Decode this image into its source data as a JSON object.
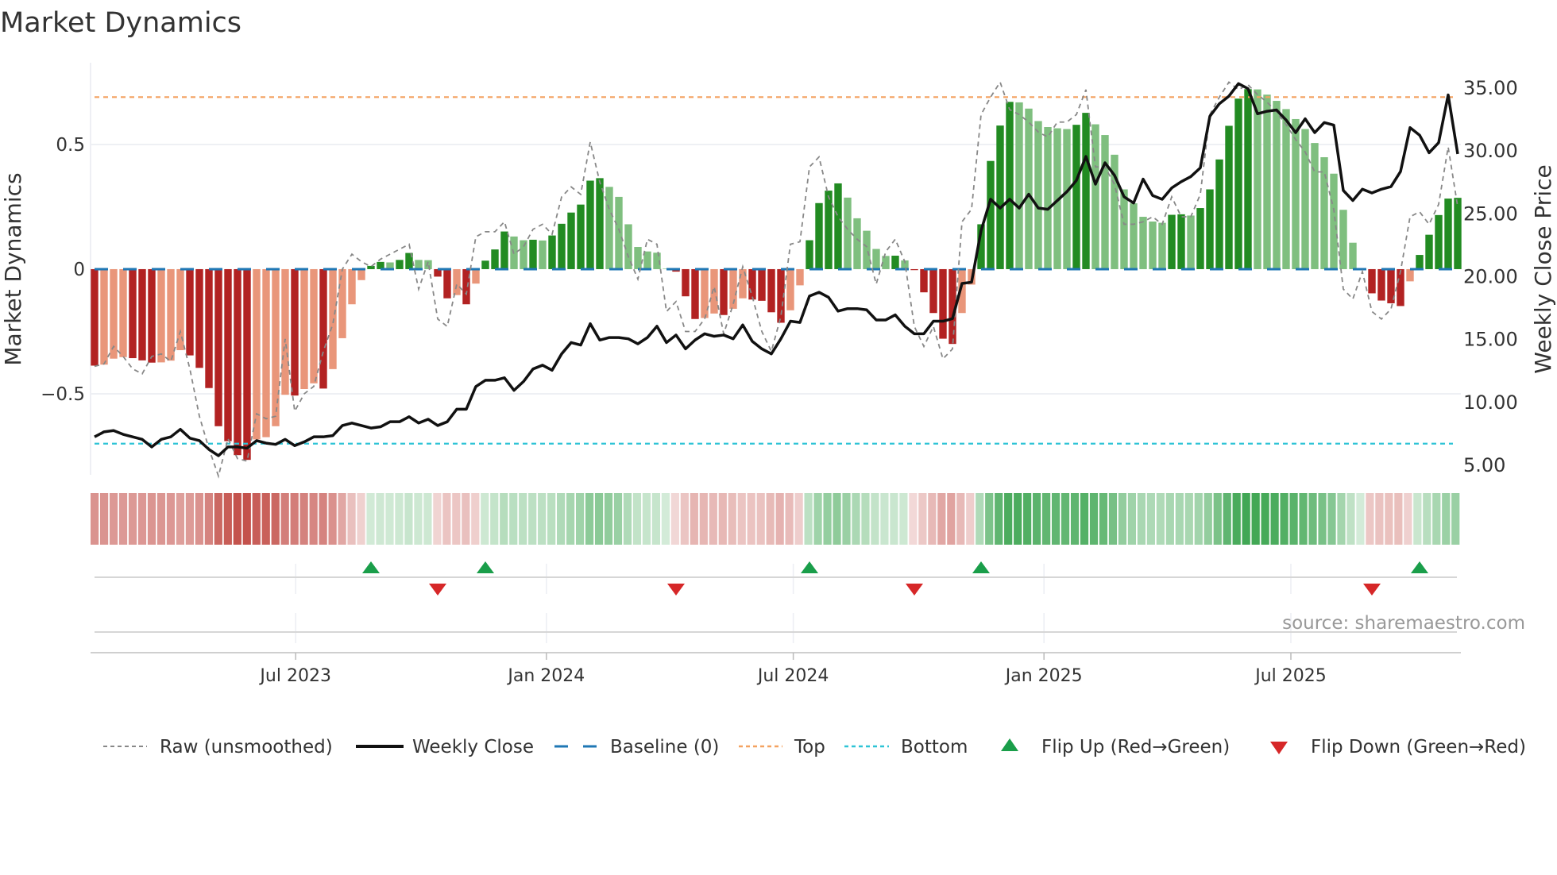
{
  "chart_data": {
    "type": "bar",
    "title": "Market Dynamics",
    "ylabel": "Market Dynamics",
    "y2label": "Weekly Close Price",
    "ylim": [
      -0.825,
      0.828
    ],
    "y2lim": [
      4.18,
      36.96
    ],
    "yticks": [
      {
        "value": 0.5,
        "label": "0.5"
      },
      {
        "value": 0,
        "label": "0"
      },
      {
        "value": -0.5,
        "label": "−0.5"
      }
    ],
    "y2ticks": [
      {
        "value": 35,
        "label": "35.00"
      },
      {
        "value": 30,
        "label": "30.00"
      },
      {
        "value": 25,
        "label": "25.00"
      },
      {
        "value": 20,
        "label": "20.00"
      },
      {
        "value": 15,
        "label": "15.00"
      },
      {
        "value": 10,
        "label": "10.00"
      },
      {
        "value": 5,
        "label": "5.00"
      }
    ],
    "x_unit": "week index",
    "xticks": [
      {
        "week": 21.1,
        "label": "Jul 2023"
      },
      {
        "week": 47.4,
        "label": "Jan 2024"
      },
      {
        "week": 73.3,
        "label": "Jul 2024"
      },
      {
        "week": 99.6,
        "label": "Jan 2025"
      },
      {
        "week": 125.5,
        "label": "Jul 2025"
      }
    ],
    "top_level": 0.69,
    "bottom_level": -0.7,
    "baseline": 0,
    "series": [
      {
        "name": "Market Dynamics (smoothed)",
        "type": "bar",
        "values": [
          -0.387,
          -0.383,
          -0.359,
          -0.353,
          -0.357,
          -0.366,
          -0.375,
          -0.374,
          -0.367,
          -0.325,
          -0.346,
          -0.396,
          -0.477,
          -0.63,
          -0.69,
          -0.746,
          -0.765,
          -0.683,
          -0.674,
          -0.63,
          -0.504,
          -0.507,
          -0.481,
          -0.458,
          -0.479,
          -0.401,
          -0.277,
          -0.141,
          -0.044,
          0.013,
          0.029,
          0.027,
          0.037,
          0.065,
          0.037,
          0.036,
          -0.03,
          -0.117,
          -0.104,
          -0.141,
          -0.058,
          0.034,
          0.079,
          0.151,
          0.131,
          0.116,
          0.118,
          0.115,
          0.135,
          0.182,
          0.227,
          0.259,
          0.355,
          0.365,
          0.33,
          0.29,
          0.18,
          0.089,
          0.071,
          0.066,
          0.002,
          -0.01,
          -0.109,
          -0.2,
          -0.196,
          -0.178,
          -0.184,
          -0.159,
          -0.117,
          -0.122,
          -0.127,
          -0.173,
          -0.215,
          -0.165,
          -0.065,
          0.116,
          0.265,
          0.315,
          0.344,
          0.287,
          0.204,
          0.154,
          0.081,
          0.053,
          0.054,
          0.035,
          -0.004,
          -0.093,
          -0.176,
          -0.279,
          -0.3,
          -0.176,
          -0.062,
          0.18,
          0.434,
          0.576,
          0.671,
          0.669,
          0.644,
          0.594,
          0.57,
          0.565,
          0.562,
          0.579,
          0.627,
          0.581,
          0.538,
          0.459,
          0.32,
          0.264,
          0.21,
          0.191,
          0.186,
          0.218,
          0.22,
          0.215,
          0.245,
          0.32,
          0.44,
          0.575,
          0.684,
          0.722,
          0.721,
          0.7,
          0.675,
          0.642,
          0.602,
          0.562,
          0.506,
          0.449,
          0.383,
          0.238,
          0.106,
          0.003,
          -0.097,
          -0.126,
          -0.137,
          -0.148,
          -0.049,
          0.057,
          0.138,
          0.217,
          0.283,
          0.286
        ]
      },
      {
        "name": "Raw (unsmoothed)",
        "type": "line",
        "values": [
          -0.39,
          -0.38,
          -0.31,
          -0.35,
          -0.4,
          -0.42,
          -0.35,
          -0.34,
          -0.37,
          -0.25,
          -0.4,
          -0.59,
          -0.72,
          -0.83,
          -0.68,
          -0.76,
          -0.77,
          -0.58,
          -0.6,
          -0.59,
          -0.28,
          -0.57,
          -0.5,
          -0.47,
          -0.33,
          -0.22,
          0.0,
          0.06,
          0.03,
          0.01,
          0.04,
          0.06,
          0.08,
          0.1,
          -0.08,
          0.03,
          -0.2,
          -0.23,
          -0.06,
          -0.1,
          0.13,
          0.15,
          0.15,
          0.19,
          0.06,
          0.09,
          0.16,
          0.18,
          0.14,
          0.29,
          0.33,
          0.3,
          0.51,
          0.35,
          0.24,
          0.16,
          0.05,
          -0.04,
          0.12,
          0.1,
          -0.17,
          -0.13,
          -0.25,
          -0.25,
          -0.2,
          -0.07,
          -0.26,
          -0.14,
          0.01,
          -0.11,
          -0.25,
          -0.33,
          -0.19,
          0.1,
          0.11,
          0.41,
          0.45,
          0.29,
          0.21,
          0.16,
          0.12,
          0.09,
          -0.06,
          0.07,
          0.12,
          0.03,
          -0.23,
          -0.31,
          -0.23,
          -0.36,
          -0.32,
          0.19,
          0.24,
          0.62,
          0.69,
          0.75,
          0.64,
          0.62,
          0.59,
          0.55,
          0.53,
          0.59,
          0.59,
          0.62,
          0.72,
          0.41,
          0.41,
          0.34,
          0.18,
          0.18,
          0.19,
          0.21,
          0.18,
          0.29,
          0.21,
          0.21,
          0.3,
          0.62,
          0.69,
          0.75,
          0.72,
          0.74,
          0.7,
          0.67,
          0.63,
          0.58,
          0.52,
          0.47,
          0.39,
          0.39,
          0.24,
          -0.08,
          -0.12,
          -0.01,
          -0.17,
          -0.2,
          -0.16,
          -0.01,
          0.21,
          0.23,
          0.18,
          0.26,
          0.49,
          0.25
        ]
      },
      {
        "name": "Weekly Close",
        "type": "line",
        "axis": "right",
        "values": [
          7.2,
          7.6,
          7.7,
          7.4,
          7.2,
          7.0,
          6.4,
          7.0,
          7.2,
          7.8,
          7.1,
          6.9,
          6.2,
          5.7,
          6.4,
          6.4,
          6.3,
          6.9,
          6.7,
          6.6,
          7.0,
          6.5,
          6.8,
          7.2,
          7.2,
          7.3,
          8.1,
          8.3,
          8.1,
          7.9,
          8.0,
          8.4,
          8.4,
          8.8,
          8.3,
          8.6,
          8.1,
          8.4,
          9.4,
          9.4,
          11.2,
          11.7,
          11.7,
          11.9,
          10.9,
          11.6,
          12.6,
          12.9,
          12.5,
          13.8,
          14.7,
          14.5,
          16.2,
          14.9,
          15.1,
          15.1,
          15.0,
          14.6,
          15.1,
          16.0,
          14.7,
          15.3,
          14.2,
          14.9,
          15.4,
          15.2,
          15.3,
          15.0,
          16.1,
          14.8,
          14.2,
          13.8,
          15.0,
          16.4,
          16.3,
          18.4,
          18.7,
          18.3,
          17.2,
          17.4,
          17.4,
          17.3,
          16.5,
          16.5,
          16.9,
          16.0,
          15.4,
          15.4,
          16.4,
          16.4,
          16.6,
          19.4,
          19.5,
          23.6,
          26.1,
          25.4,
          26.1,
          25.4,
          26.5,
          25.4,
          25.3,
          26.0,
          26.7,
          27.6,
          29.5,
          27.3,
          29.0,
          28.0,
          26.3,
          25.8,
          27.7,
          26.4,
          26.1,
          27.0,
          27.5,
          27.9,
          28.6,
          32.7,
          33.7,
          34.3,
          35.3,
          34.9,
          32.9,
          33.1,
          33.2,
          32.4,
          31.4,
          32.5,
          31.4,
          32.2,
          32.0,
          26.8,
          26.0,
          26.9,
          26.6,
          26.9,
          27.1,
          28.3,
          31.8,
          31.2,
          29.8,
          30.6,
          34.4,
          29.7
        ]
      }
    ],
    "flips_up": [
      29,
      41,
      75,
      93,
      139
    ],
    "flips_down": [
      36,
      61,
      86,
      134
    ],
    "legend": {
      "placement": "bottom",
      "items": [
        {
          "key": "raw",
          "label": "Raw (unsmoothed)"
        },
        {
          "key": "close",
          "label": "Weekly Close"
        },
        {
          "key": "baseline",
          "label": "Baseline (0)"
        },
        {
          "key": "top",
          "label": "Top"
        },
        {
          "key": "bottom",
          "label": "Bottom"
        },
        {
          "key": "flip_up",
          "label": "Flip Up (Red→Green)"
        },
        {
          "key": "flip_down",
          "label": "Flip Down (Green→Red)"
        }
      ]
    },
    "source": "source: sharemaestro.com",
    "colors": {
      "bar_up_strong": "#228b22",
      "bar_up_weak": "#7fbf7f",
      "bar_down_strong": "#b22222",
      "bar_down_weak": "#e9967a",
      "raw": "#888888",
      "close": "#111111",
      "baseline": "#1f77b4",
      "top": "#f4a261",
      "bottom": "#2ec4d6",
      "flip_up": "#1a9e4a",
      "flip_down": "#d62728"
    }
  }
}
